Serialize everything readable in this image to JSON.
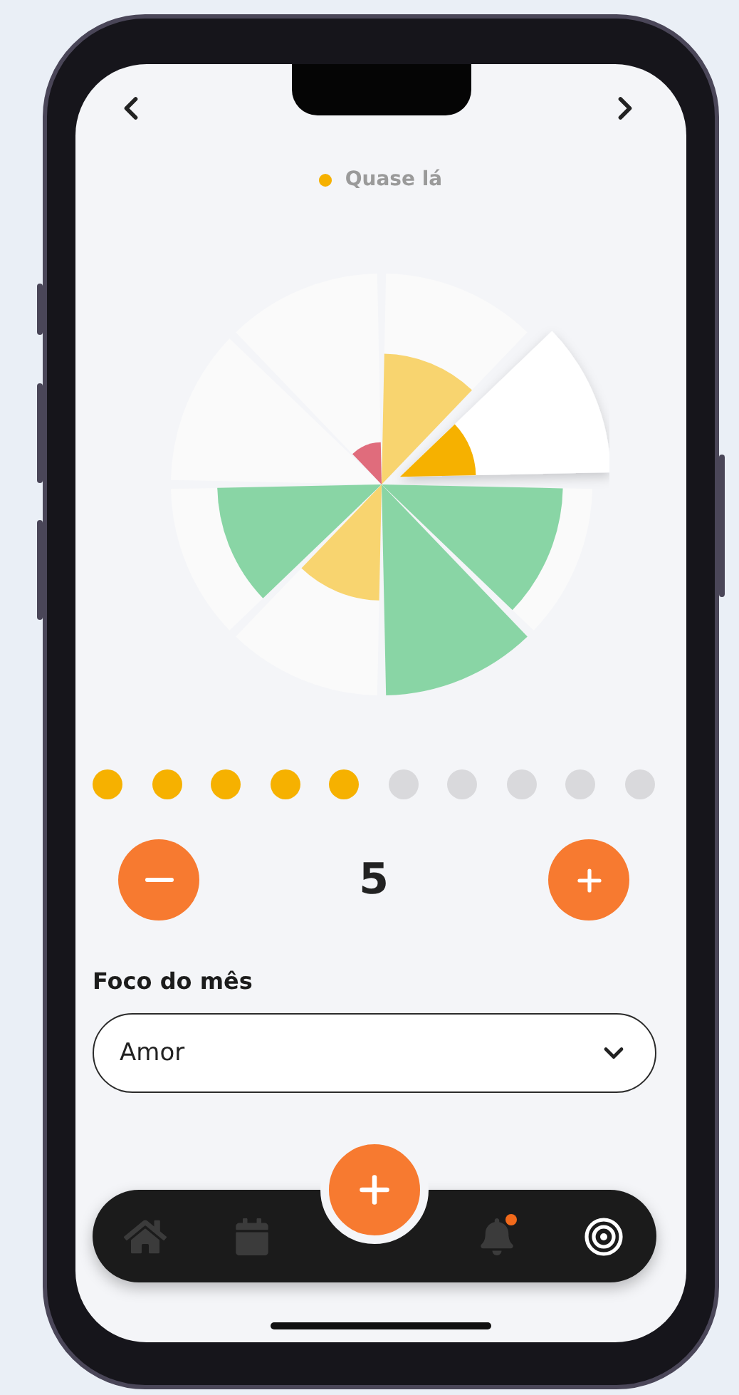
{
  "header": {
    "status": {
      "label": "Quase lá",
      "color": "#f6b100"
    }
  },
  "wheel": {
    "sectors": [
      {
        "level": 0.62,
        "color": "#f8d46f",
        "selected": false
      },
      {
        "level": 0.36,
        "color": "#f6b100",
        "selected": true
      },
      {
        "level": 0.86,
        "color": "#89d5a5",
        "selected": false
      },
      {
        "level": 1.0,
        "color": "#89d5a5",
        "selected": false
      },
      {
        "level": 0.55,
        "color": "#f8d46f",
        "selected": false
      },
      {
        "level": 0.78,
        "color": "#89d5a5",
        "selected": false
      },
      {
        "selected": false
      },
      {
        "level": 0.2,
        "color": "#e06c7c",
        "selected": false
      }
    ]
  },
  "score_dots": [
    {
      "filled": true
    },
    {
      "filled": true
    },
    {
      "filled": true
    },
    {
      "filled": true
    },
    {
      "filled": true
    },
    {
      "filled": false
    },
    {
      "filled": false
    },
    {
      "filled": false
    },
    {
      "filled": false
    },
    {
      "filled": false
    }
  ],
  "stepper": {
    "value": "5"
  },
  "focus": {
    "label": "Foco do mês",
    "value": "Amor"
  },
  "nav": {
    "items": [
      {
        "kind": "home",
        "selected": false,
        "badge": false
      },
      {
        "kind": "calendar",
        "selected": false,
        "badge": false
      },
      {
        "kind": "bell",
        "selected": false,
        "badge": true
      },
      {
        "kind": "target",
        "selected": true,
        "badge": false
      }
    ]
  }
}
